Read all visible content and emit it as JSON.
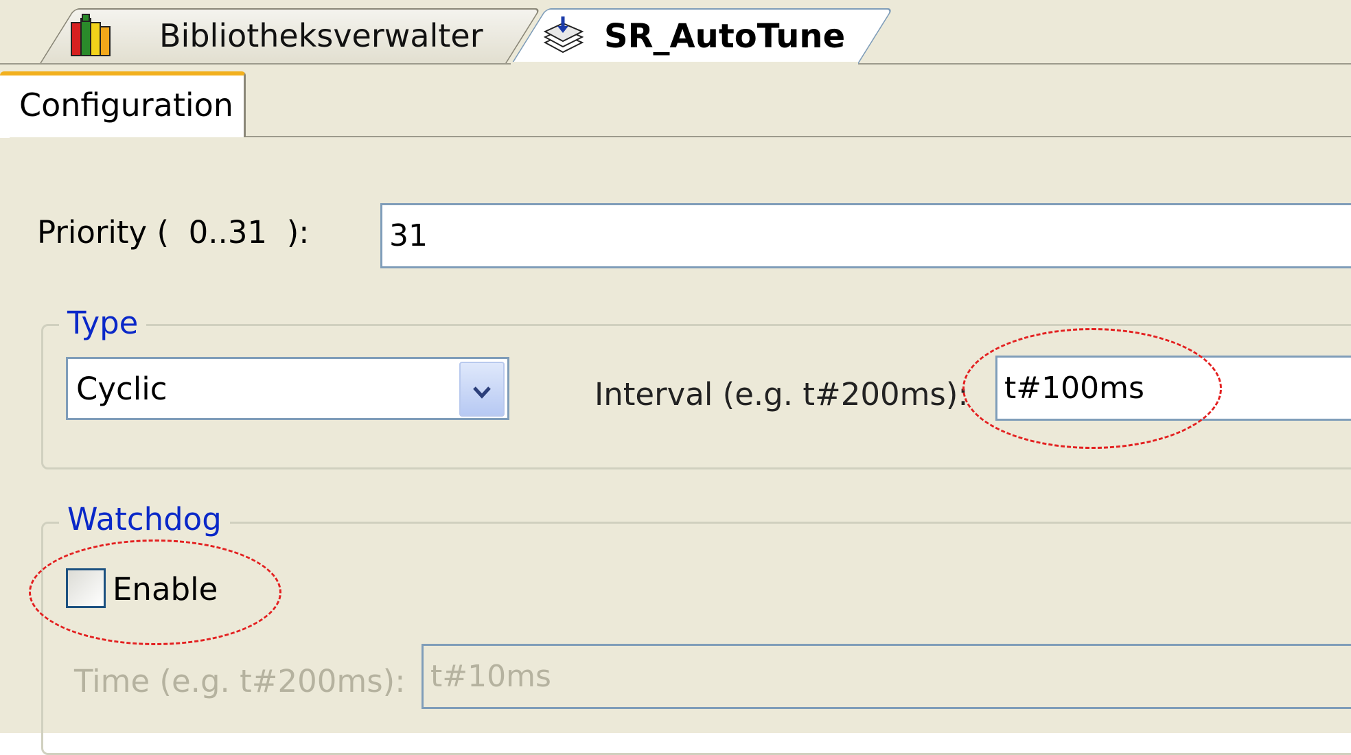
{
  "editor_tabs": [
    {
      "label": "Bibliotheksverwalter",
      "icon": "library-books-icon",
      "active": false
    },
    {
      "label": "SR_AutoTune",
      "icon": "task-stack-icon",
      "active": true
    }
  ],
  "sub_tabs": [
    {
      "label": "Configuration",
      "active": true
    }
  ],
  "priority": {
    "label": "Priority (  0..31  ):",
    "value": "31"
  },
  "type_group": {
    "title": "Type",
    "select_value": "Cyclic",
    "interval_label": "Interval (e.g. t#200ms):",
    "interval_value": "t#100ms"
  },
  "watchdog_group": {
    "title": "Watchdog",
    "enable_label": "Enable",
    "enable_checked": false,
    "time_label": "Time (e.g. t#200ms):",
    "time_value": "t#10ms"
  },
  "colors": {
    "annotation": "#e32020",
    "group_title": "#0a28c8",
    "active_subtab_accent": "#f2b01e",
    "disabled_text": "#b5b29f"
  }
}
